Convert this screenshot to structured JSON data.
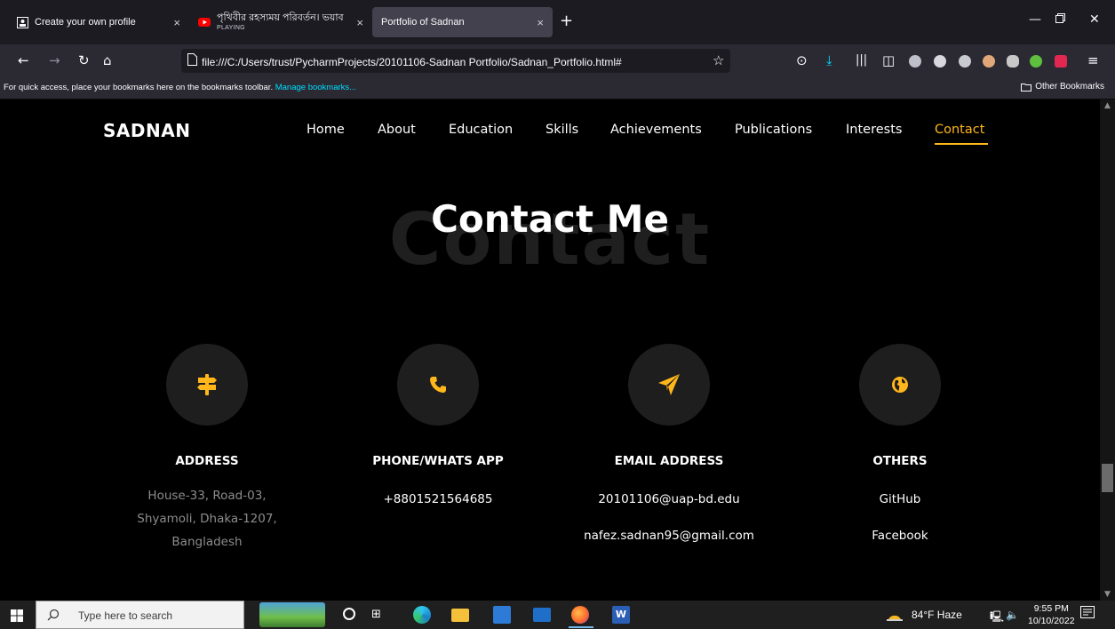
{
  "browser": {
    "tabs": [
      {
        "title": "Create your own profile",
        "icon": "profile-tab-icon"
      },
      {
        "title": "পৃথিবীর রহস্যময় পরিবর্তন। ভয়াব",
        "subtitle": "PLAYING",
        "icon": "youtube-icon"
      },
      {
        "title": "Portfolio of Sadnan",
        "icon": "page-icon",
        "active": true
      }
    ],
    "url": "file:///C:/Users/trust/PycharmProjects/20101106-Sadnan Portfolio/Sadnan_Portfolio.html#",
    "bookmarks_hint": "For quick access, place your bookmarks here on the bookmarks toolbar.",
    "bookmarks_link": "Manage bookmarks...",
    "other_bookmarks": "Other Bookmarks"
  },
  "site": {
    "brand": "SADNAN",
    "nav": [
      "Home",
      "About",
      "Education",
      "Skills",
      "Achievements",
      "Publications",
      "Interests",
      "Contact"
    ],
    "active_nav": "Contact",
    "accent": "#ffb71b",
    "section_bg_word": "Contact",
    "section_title": "Contact Me",
    "contacts": [
      {
        "icon": "signpost-icon",
        "title": "ADDRESS",
        "lines": [
          "House-33, Road-03,",
          "Shyamoli, Dhaka-1207,",
          "Bangladesh"
        ]
      },
      {
        "icon": "phone-icon",
        "title": "PHONE/WHATS APP",
        "lines": [
          "+8801521564685"
        ]
      },
      {
        "icon": "paper-plane-icon",
        "title": "EMAIL ADDRESS",
        "lines": [
          "20101106@uap-bd.edu",
          "nafez.sadnan95@gmail.com"
        ]
      },
      {
        "icon": "globe-icon",
        "title": "OTHERS",
        "lines": [
          "GitHub",
          "Facebook"
        ]
      }
    ]
  },
  "taskbar": {
    "search_placeholder": "Type here to search",
    "weather": "84°F  Haze",
    "time": "9:55 PM",
    "date": "10/10/2022"
  }
}
